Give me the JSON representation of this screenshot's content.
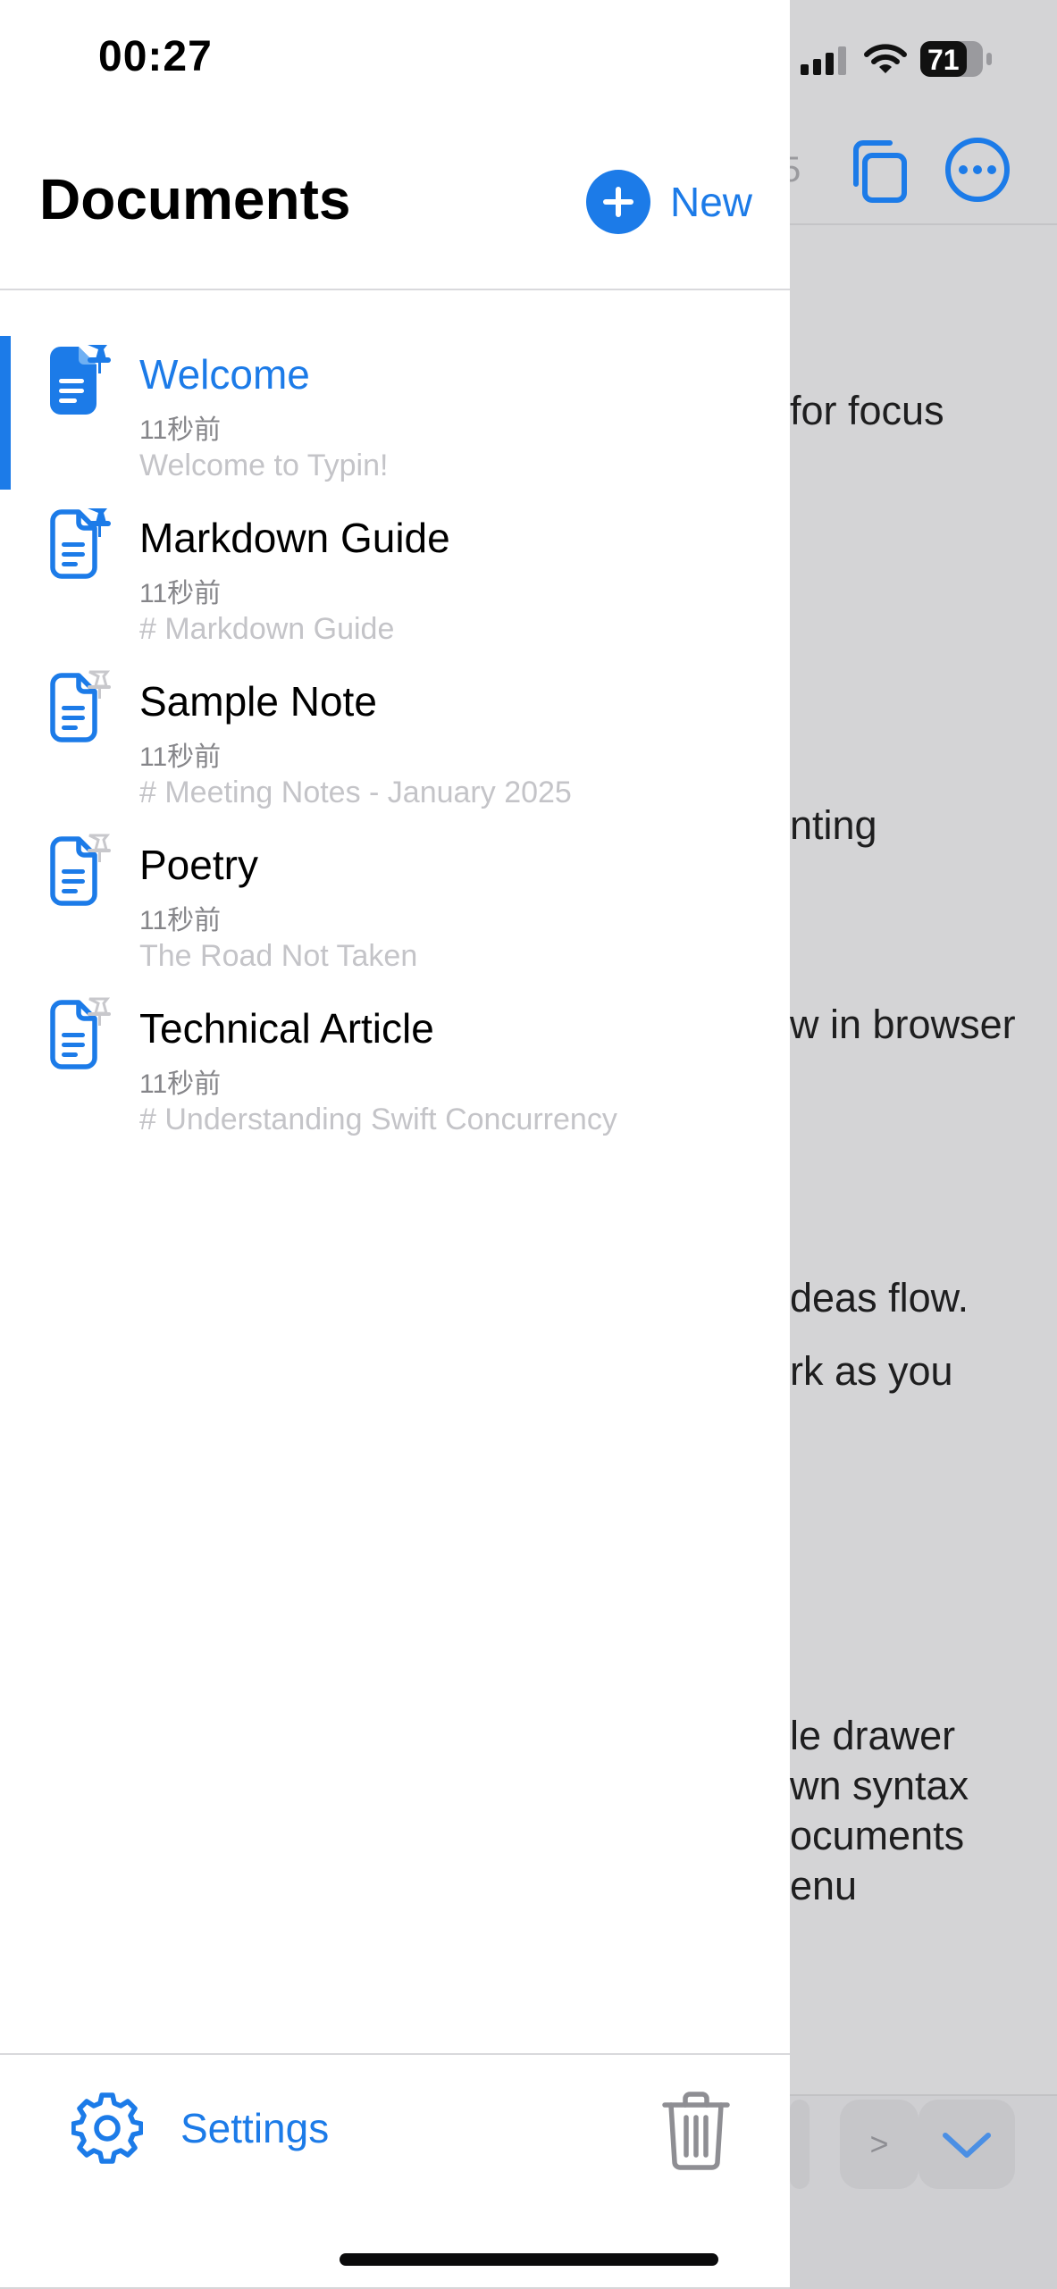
{
  "status_bar": {
    "time": "00:27",
    "battery": "71"
  },
  "drawer": {
    "title": "Documents",
    "new_label": "New",
    "documents": [
      {
        "title": "Welcome",
        "time": "11秒前",
        "preview": "Welcome to Typin!",
        "selected": true,
        "pinned": true
      },
      {
        "title": "Markdown Guide",
        "time": "11秒前",
        "preview": "# Markdown Guide",
        "selected": false,
        "pinned": true
      },
      {
        "title": "Sample Note",
        "time": "11秒前",
        "preview": "# Meeting Notes - January 2025",
        "selected": false,
        "pinned": false
      },
      {
        "title": "Poetry",
        "time": "11秒前",
        "preview": "The Road Not Taken",
        "selected": false,
        "pinned": false
      },
      {
        "title": "Technical Article",
        "time": "11秒前",
        "preview": "# Understanding Swift Concurrency",
        "selected": false,
        "pinned": false
      }
    ],
    "settings_label": "Settings"
  },
  "background_editor": {
    "count_fragment": "5",
    "text_fragments": [
      "for focus",
      "nting",
      "w in browser",
      "deas flow.",
      "rk as you",
      "le drawer",
      "wn syntax",
      "ocuments",
      "enu"
    ],
    "toolbar_key": ">"
  },
  "colors": {
    "accent": "#1c7be8",
    "pin_inactive": "#d0d0d4"
  }
}
